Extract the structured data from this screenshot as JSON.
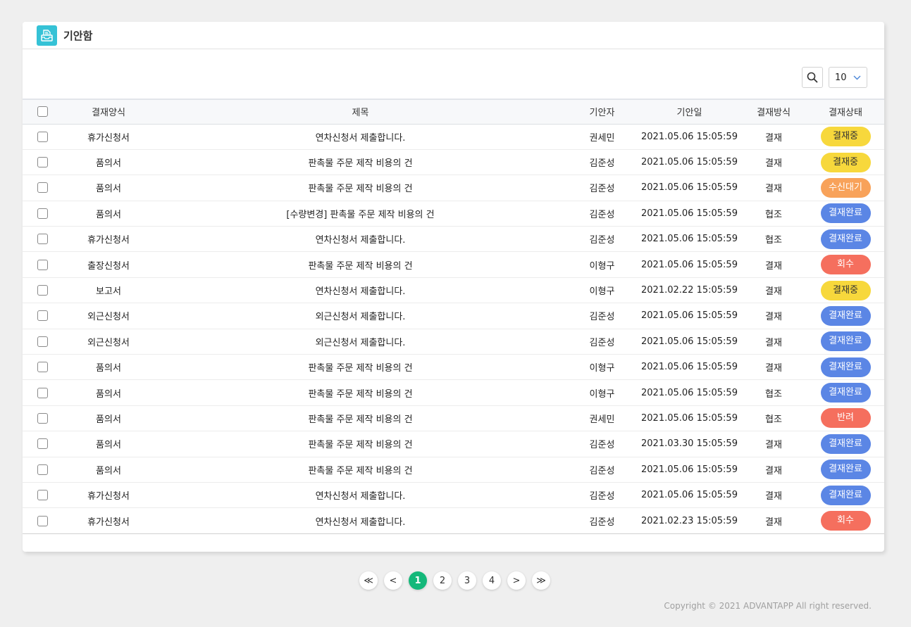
{
  "header": {
    "title": "기안함",
    "icon": "inbox-tray-icon"
  },
  "toolbar": {
    "page_size": "10"
  },
  "table": {
    "columns": [
      "결재양식",
      "제목",
      "기안자",
      "기안일",
      "결재방식",
      "결재상태"
    ],
    "rows": [
      {
        "form": "휴가신청서",
        "title": "연차신청서 제출합니다.",
        "drafter": "권세민",
        "date": "2021.05.06  15:05:59",
        "method": "결재",
        "status": "결재중"
      },
      {
        "form": "품의서",
        "title": "판촉물 주문 제작 비용의 건",
        "drafter": "김준성",
        "date": "2021.05.06  15:05:59",
        "method": "결재",
        "status": "결재중"
      },
      {
        "form": "품의서",
        "title": "판촉물 주문 제작 비용의 건",
        "drafter": "김준성",
        "date": "2021.05.06  15:05:59",
        "method": "결재",
        "status": "수신대기"
      },
      {
        "form": "품의서",
        "title": "[수량변경] 판촉물 주문 제작 비용의 건",
        "drafter": "김준성",
        "date": "2021.05.06  15:05:59",
        "method": "협조",
        "status": "결재완료"
      },
      {
        "form": "휴가신청서",
        "title": "연차신청서 제출합니다.",
        "drafter": "김준성",
        "date": "2021.05.06  15:05:59",
        "method": "협조",
        "status": "결재완료"
      },
      {
        "form": "출장신청서",
        "title": "판촉물 주문 제작 비용의 건",
        "drafter": "이형구",
        "date": "2021.05.06  15:05:59",
        "method": "결재",
        "status": "회수"
      },
      {
        "form": "보고서",
        "title": "연차신청서 제출합니다.",
        "drafter": "이형구",
        "date": "2021.02.22  15:05:59",
        "method": "결재",
        "status": "결재중"
      },
      {
        "form": "외근신청서",
        "title": "외근신청서 제출합니다.",
        "drafter": "김준성",
        "date": "2021.05.06  15:05:59",
        "method": "결재",
        "status": "결재완료"
      },
      {
        "form": "외근신청서",
        "title": "외근신청서 제출합니다.",
        "drafter": "김준성",
        "date": "2021.05.06  15:05:59",
        "method": "결재",
        "status": "결재완료"
      },
      {
        "form": "품의서",
        "title": "판촉물 주문 제작 비용의 건",
        "drafter": "이형구",
        "date": "2021.05.06  15:05:59",
        "method": "결재",
        "status": "결재완료"
      },
      {
        "form": "품의서",
        "title": "판촉물 주문 제작 비용의 건",
        "drafter": "이형구",
        "date": "2021.05.06  15:05:59",
        "method": "협조",
        "status": "결재완료"
      },
      {
        "form": "품의서",
        "title": "판촉물 주문 제작 비용의 건",
        "drafter": "권세민",
        "date": "2021.05.06  15:05:59",
        "method": "협조",
        "status": "반려"
      },
      {
        "form": "품의서",
        "title": "판촉물 주문 제작 비용의 건",
        "drafter": "김준성",
        "date": "2021.03.30  15:05:59",
        "method": "결재",
        "status": "결재완료"
      },
      {
        "form": "품의서",
        "title": "판촉물 주문 제작 비용의 건",
        "drafter": "김준성",
        "date": "2021.05.06  15:05:59",
        "method": "결재",
        "status": "결재완료"
      },
      {
        "form": "휴가신청서",
        "title": "연차신청서 제출합니다.",
        "drafter": "김준성",
        "date": "2021.05.06  15:05:59",
        "method": "결재",
        "status": "결재완료"
      },
      {
        "form": "휴가신청서",
        "title": "연차신청서 제출합니다.",
        "drafter": "김준성",
        "date": "2021.02.23  15:05:59",
        "method": "결재",
        "status": "회수"
      }
    ]
  },
  "status_colors": {
    "결재중": {
      "bg": "#f7d83c",
      "fg": "#333333"
    },
    "수신대기": {
      "bg": "#f8a25a",
      "fg": "#ffffff"
    },
    "결재완료": {
      "bg": "#5b86e5",
      "fg": "#ffffff"
    },
    "회수": {
      "bg": "#f56f5e",
      "fg": "#ffffff"
    },
    "반려": {
      "bg": "#f56f5e",
      "fg": "#ffffff"
    }
  },
  "pagination": {
    "first": "≪",
    "prev": "<",
    "next": ">",
    "last": "≫",
    "pages": [
      "1",
      "2",
      "3",
      "4"
    ],
    "active": "1",
    "active_color": "#14b87a"
  },
  "footer": {
    "copyright": "Copyright © 2021 ADVANTAPP All right reserved."
  }
}
